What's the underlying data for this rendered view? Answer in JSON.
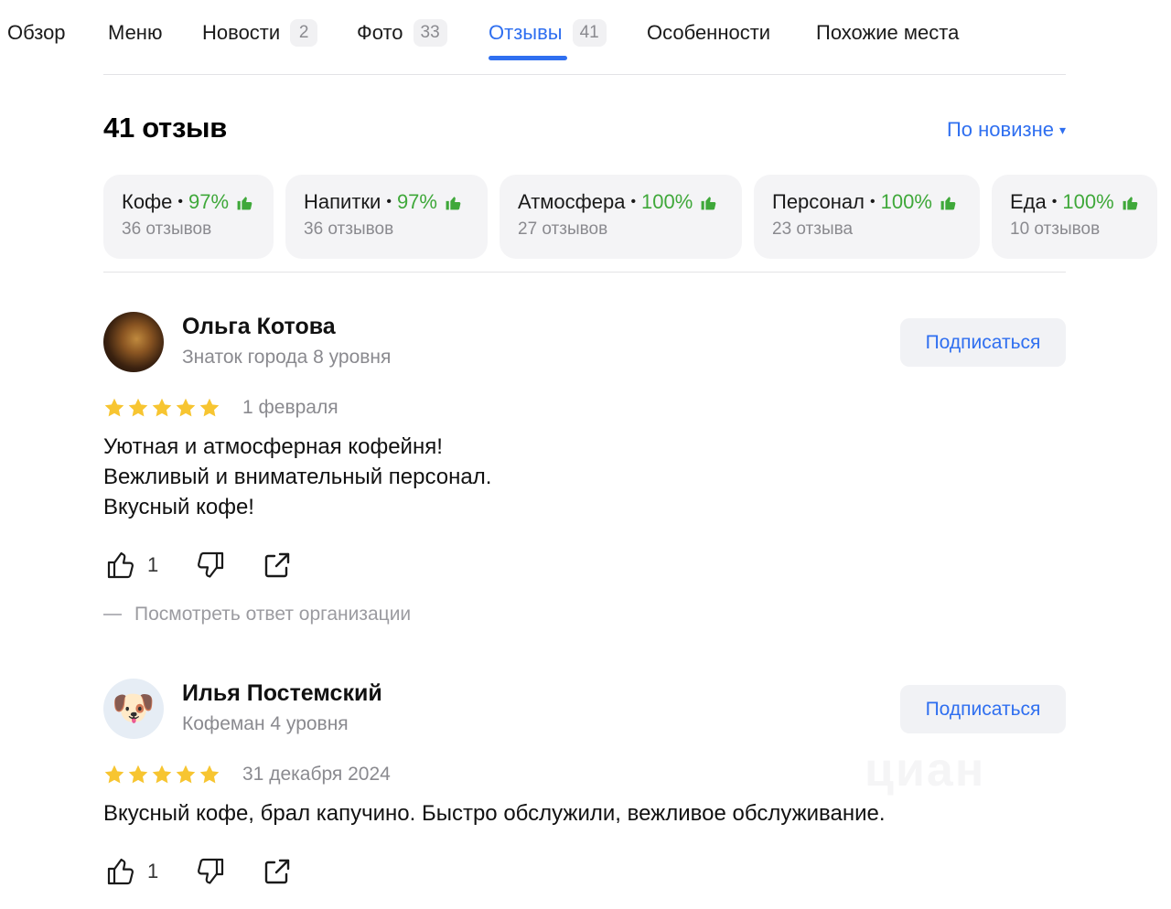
{
  "tabs": [
    {
      "label": "Обзор",
      "count": null
    },
    {
      "label": "Меню",
      "count": null
    },
    {
      "label": "Новости",
      "count": "2"
    },
    {
      "label": "Фото",
      "count": "33"
    },
    {
      "label": "Отзывы",
      "count": "41",
      "active": true
    },
    {
      "label": "Особенности",
      "count": null
    },
    {
      "label": "Похожие места",
      "count": null
    }
  ],
  "reviews_header": {
    "title": "41 отзыв",
    "sort_label": "По новизне",
    "sort_caret": "▾"
  },
  "aspects": [
    {
      "name": "Кофе",
      "percent": "97%",
      "reviews": "36 отзывов"
    },
    {
      "name": "Напитки",
      "percent": "97%",
      "reviews": "36 отзывов"
    },
    {
      "name": "Атмосфера",
      "percent": "100%",
      "reviews": "27 отзывов"
    },
    {
      "name": "Персонал",
      "percent": "100%",
      "reviews": "23 отзыва"
    },
    {
      "name": "Еда",
      "percent": "100%",
      "reviews": "10 отзывов"
    }
  ],
  "aspect_separator": "•",
  "reviews": [
    {
      "author": "Ольга Котова",
      "level": "Знаток города 8 уровня",
      "subscribe_label": "Подписаться",
      "rating": 5,
      "date": "1 февраля",
      "text_lines": [
        "Уютная и атмосферная кофейня!",
        "Вежливый и внимательный персонал.",
        "Вкусный кофе!"
      ],
      "likes": "1",
      "org_reply_label": "Посмотреть ответ организации"
    },
    {
      "author": "Илья Постемский",
      "level": "Кофеман 4 уровня",
      "subscribe_label": "Подписаться",
      "rating": 5,
      "avatar_emoji": "🐶",
      "date": "31 декабря 2024",
      "text_lines": [
        "Вкусный кофе, брал капучино. Быстро обслужили, вежливое обслуживание."
      ],
      "likes": "1"
    }
  ],
  "watermark": "циан",
  "colors": {
    "accent": "#2f6ff0",
    "positive": "#3fa83a",
    "star": "#f7c531",
    "muted": "#8a8a8f"
  },
  "icons": {
    "like": "thumbs-up-icon",
    "dislike": "thumbs-down-icon",
    "share": "share-icon",
    "star": "star-icon",
    "aspect_thumb": "thumb-up-filled-icon"
  }
}
